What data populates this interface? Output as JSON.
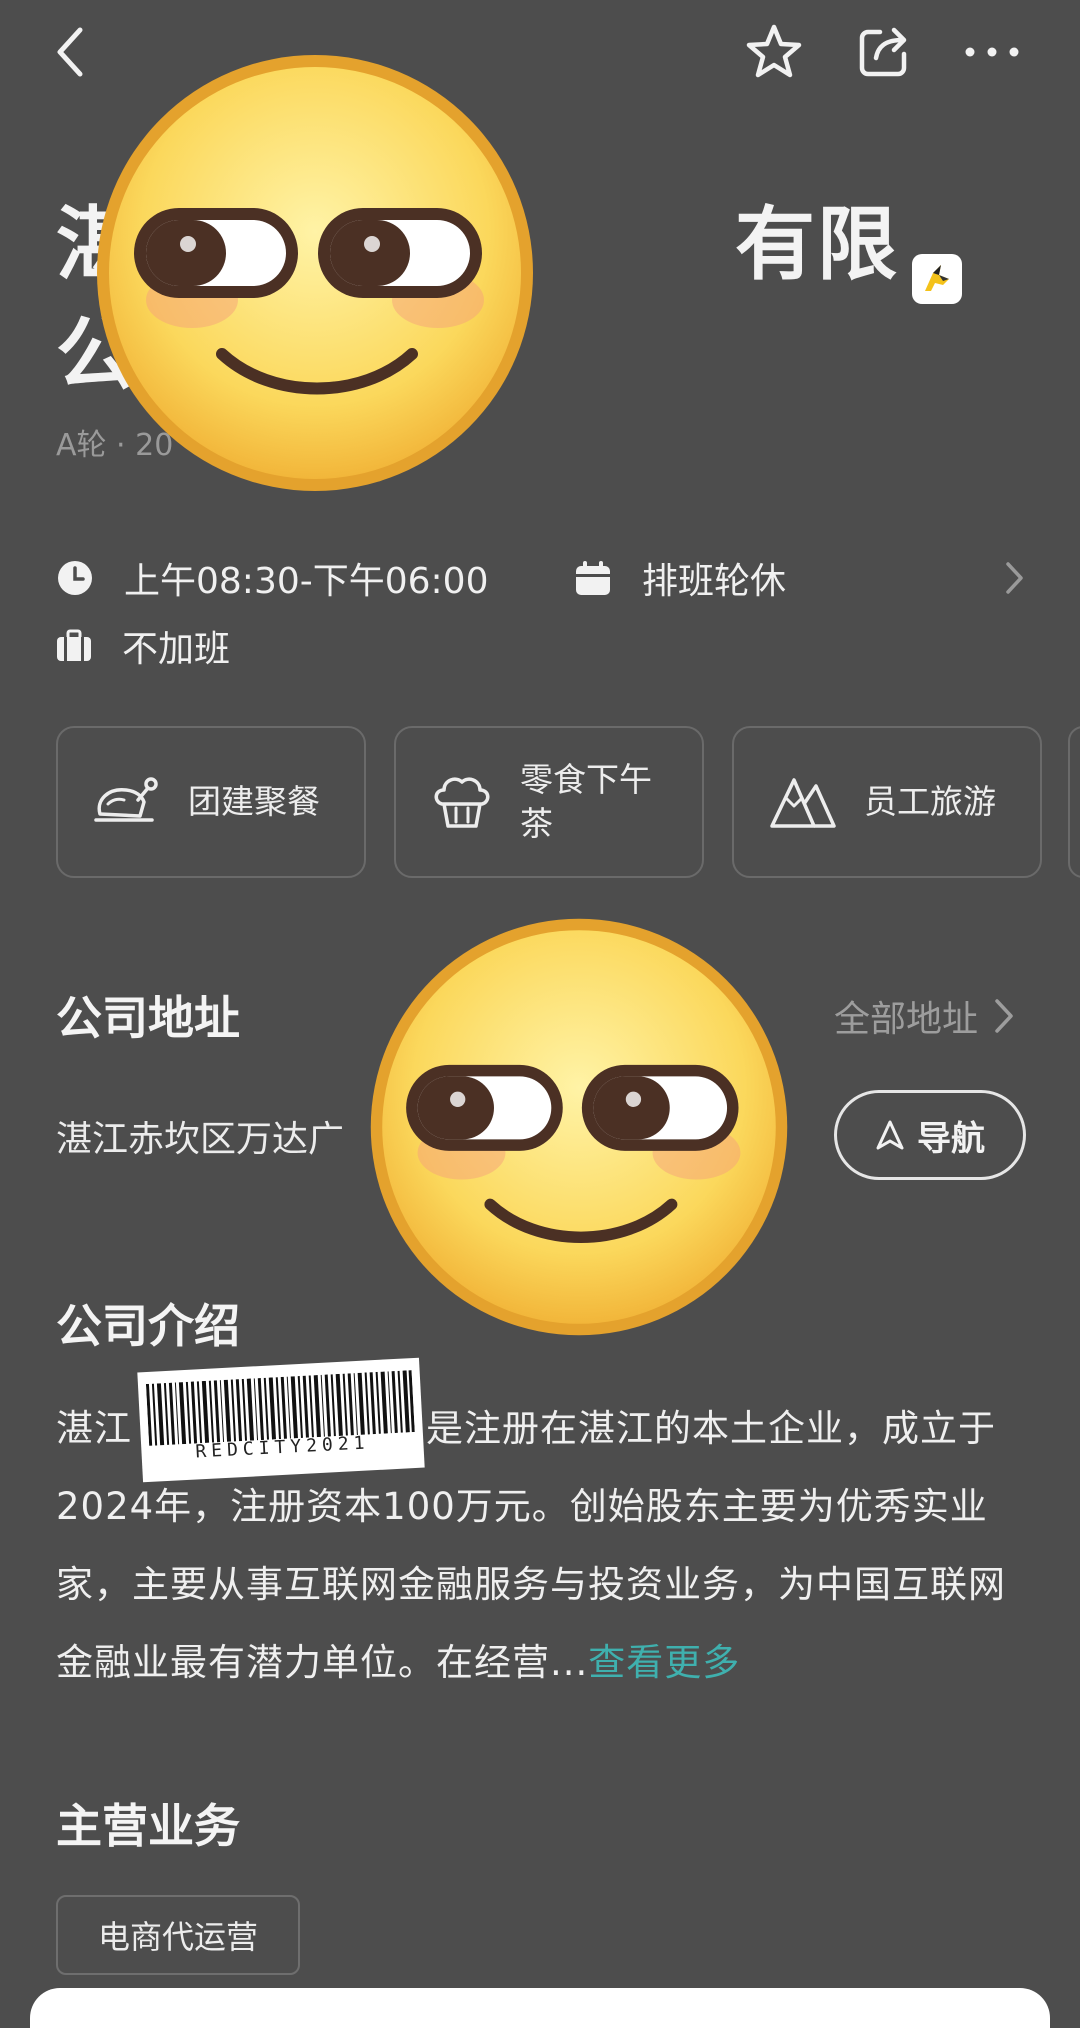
{
  "header": {
    "back_icon": "chevron-left-icon",
    "star_icon": "star-icon",
    "share_icon": "share-icon",
    "more_icon": "more-dots-icon"
  },
  "company": {
    "title_line1": "湛                    有限",
    "title_line2": "公",
    "meta": "A轮 · 20                    融"
  },
  "work_info": {
    "hours": "上午08:30-下午06:00",
    "schedule": "排班轮休",
    "overtime": "不加班"
  },
  "welfare": [
    {
      "icon": "chicken-icon",
      "label": "团建聚餐"
    },
    {
      "icon": "cake-icon",
      "label": "零食下午茶"
    },
    {
      "icon": "mountain-icon",
      "label": "员工旅游"
    }
  ],
  "address_section": {
    "title": "公司地址",
    "all_label": "全部地址",
    "address": "湛江赤坎区万达广",
    "nav_label": "导航"
  },
  "intro_section": {
    "title": "公司介绍",
    "text_start": "湛江",
    "text_body": "司是注册在湛江的本土企业，成立于2024年，注册资本100万元。创始股东主要为优秀实业家，主要从事互联网金融服务与投资业务，为中国互联网金融业最有潜力单位。在经营...",
    "more_label": "查看更多"
  },
  "business_section": {
    "title": "主营业务",
    "tag": "电商代运营"
  },
  "overlays": {
    "barcode_text": "REDCITY2021"
  },
  "colors": {
    "background": "#4d4d4d",
    "accent": "#3fb0ae"
  }
}
